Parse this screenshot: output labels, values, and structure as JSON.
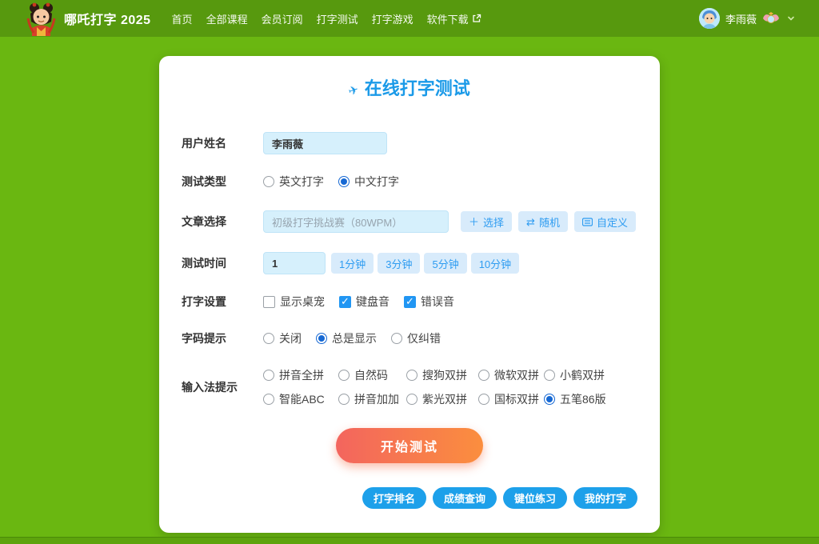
{
  "navbar": {
    "brand": "哪吒打字 2025",
    "links": [
      "首页",
      "全部课程",
      "会员订阅",
      "打字测试",
      "打字游戏",
      "软件下载"
    ],
    "user_name": "李雨薇"
  },
  "page": {
    "title": "在线打字测试",
    "title_icon": "paper-plane"
  },
  "form": {
    "username": {
      "label": "用户姓名",
      "value": "李雨薇"
    },
    "test_type": {
      "label": "测试类型",
      "options": [
        "英文打字",
        "中文打字"
      ],
      "selected": "中文打字",
      "selected_index": 1
    },
    "article": {
      "label": "文章选择",
      "value": "初级打字挑战赛（80WPM）",
      "buttons": [
        {
          "label": "选择",
          "icon": "plus-icon"
        },
        {
          "label": "随机",
          "icon": "swap-icon"
        },
        {
          "label": "自定义",
          "icon": "keyboard-icon"
        }
      ]
    },
    "duration": {
      "label": "测试时间",
      "value": "1",
      "presets": [
        "1分钟",
        "3分钟",
        "5分钟",
        "10分钟"
      ]
    },
    "settings": {
      "label": "打字设置",
      "options": [
        {
          "label": "显示桌宠",
          "checked": false
        },
        {
          "label": "键盘音",
          "checked": true
        },
        {
          "label": "错误音",
          "checked": true
        }
      ]
    },
    "hint": {
      "label": "字码提示",
      "options": [
        "关闭",
        "总是显示",
        "仅纠错"
      ],
      "selected": "总是显示",
      "selected_index": 1
    },
    "ime": {
      "label": "输入法提示",
      "options": [
        "拼音全拼",
        "自然码",
        "搜狗双拼",
        "微软双拼",
        "小鹤双拼",
        "智能ABC",
        "拼音加加",
        "紫光双拼",
        "国标双拼",
        "五笔86版"
      ],
      "selected": "五笔86版",
      "selected_index": 9
    }
  },
  "actions": {
    "start": "开始测试",
    "quick_links": [
      "打字排名",
      "成绩查询",
      "键位练习",
      "我的打字"
    ]
  },
  "colors": {
    "navbar_green": "#57990e",
    "body_green": "#6ab711",
    "accent_blue": "#1b9ae8",
    "chip_bg": "#d8ebfb",
    "chip_text": "#2e9cf1",
    "radio_selected": "#1668d3",
    "checkbox_checked": "#2196f3",
    "start_gradient_from": "#f3655e",
    "start_gradient_to": "#fb8e3e",
    "pill_blue": "#1da0ea"
  }
}
